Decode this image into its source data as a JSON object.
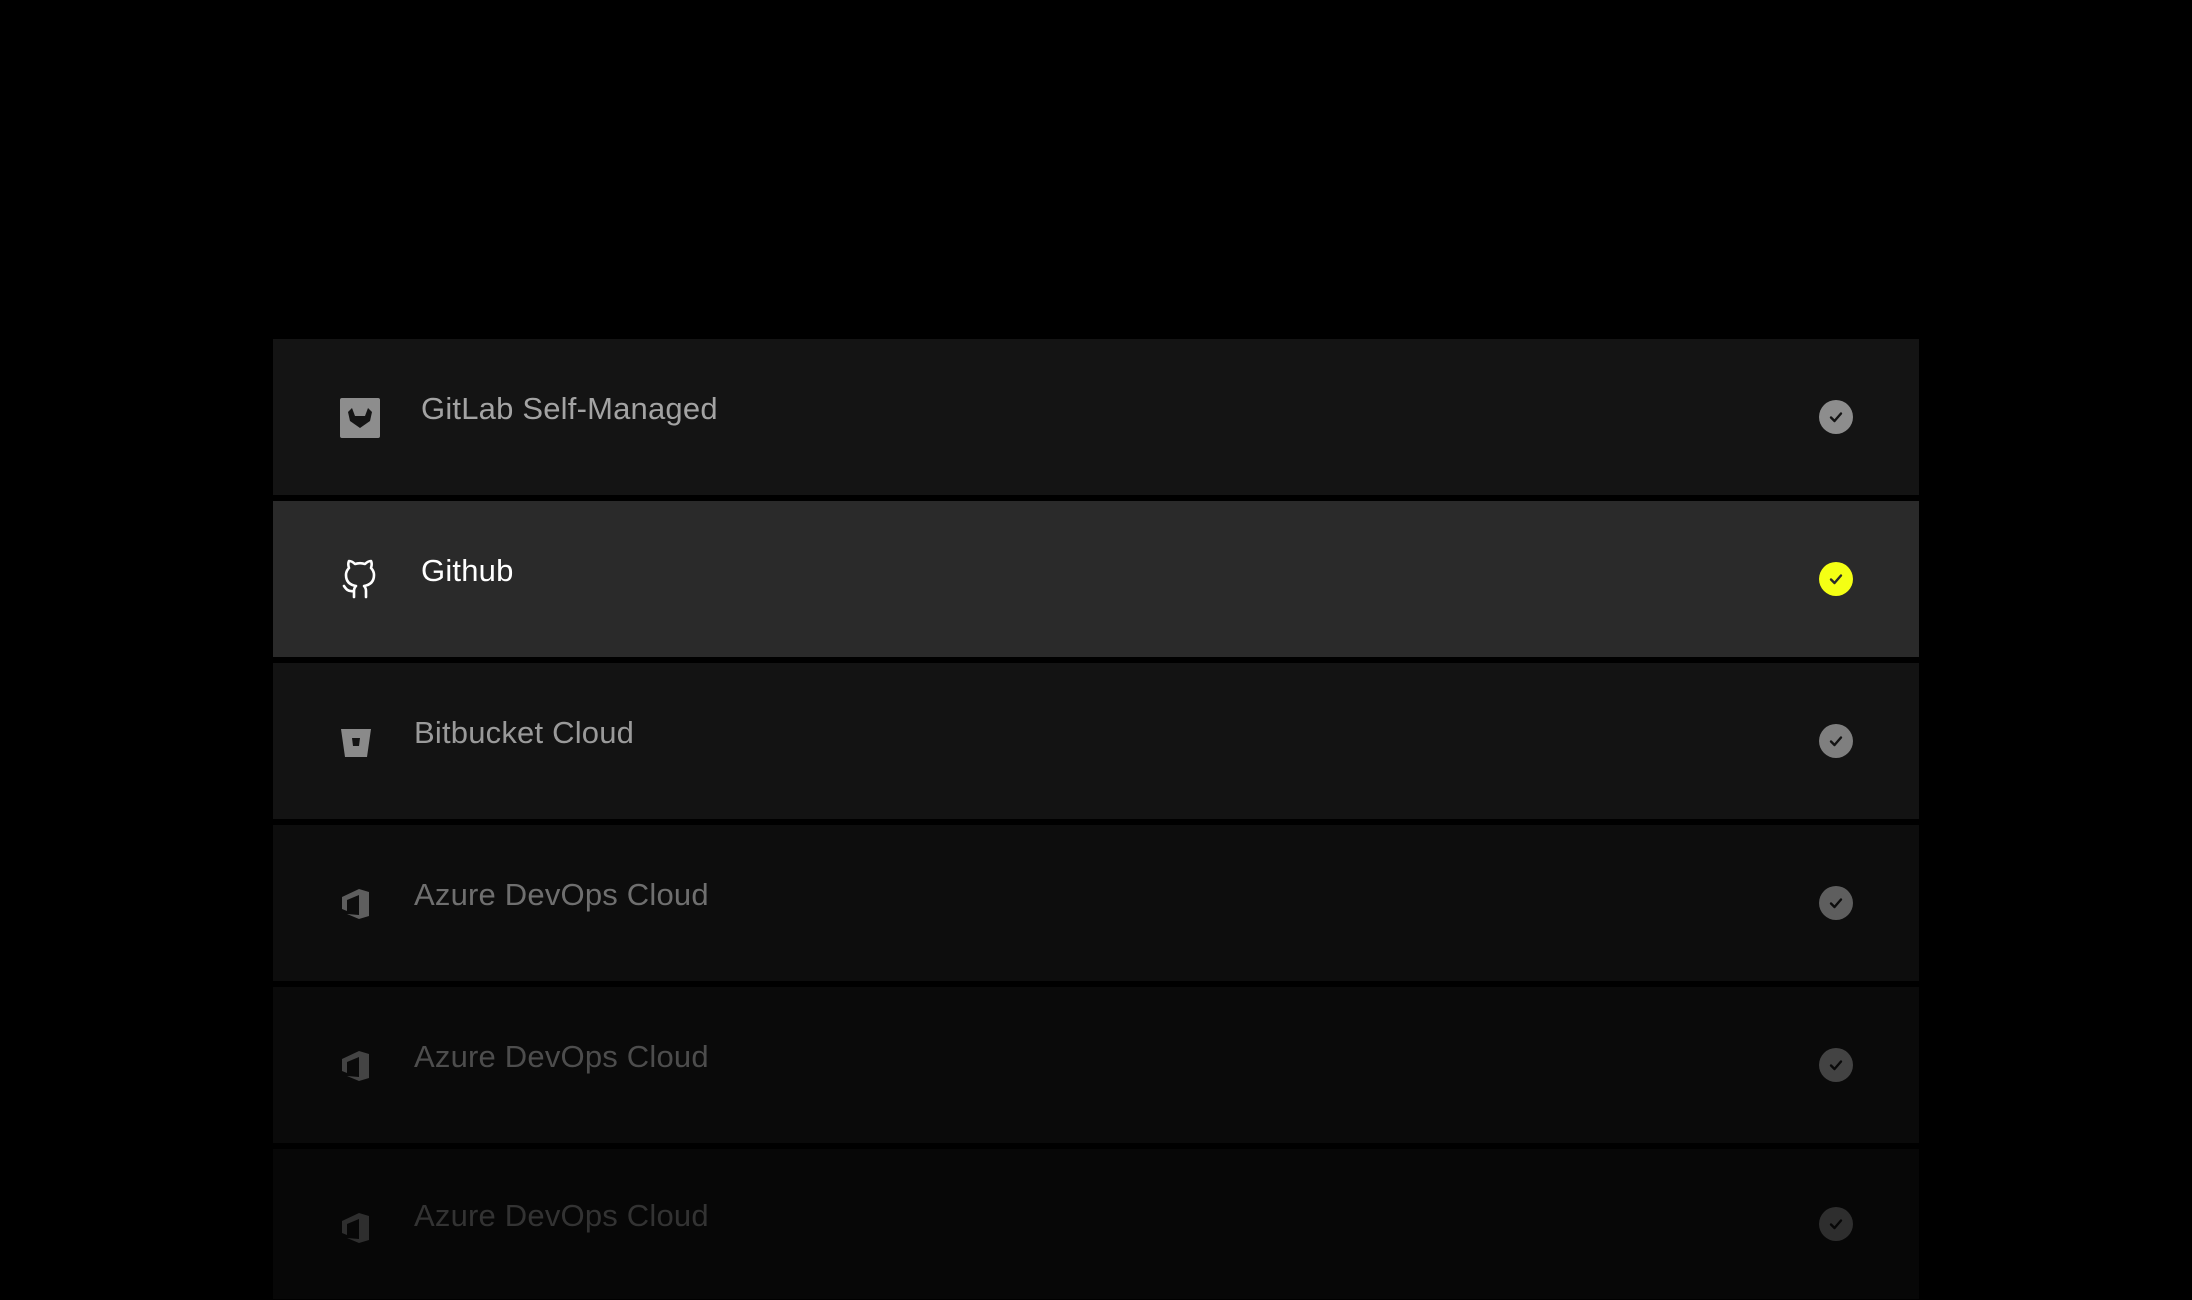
{
  "providers": [
    {
      "label": "GitLab Self-Managed",
      "icon": "gitlab-icon",
      "selected": false
    },
    {
      "label": "Github",
      "icon": "github-icon",
      "selected": true
    },
    {
      "label": "Bitbucket Cloud",
      "icon": "bitbucket-icon",
      "selected": false
    },
    {
      "label": "Azure DevOps Cloud",
      "icon": "azure-devops-icon",
      "selected": false
    },
    {
      "label": "Azure DevOps Cloud",
      "icon": "azure-devops-icon",
      "selected": false
    },
    {
      "label": "Azure DevOps Cloud",
      "icon": "azure-devops-icon",
      "selected": false
    }
  ],
  "colors": {
    "background": "#000000",
    "selected_row": "#2a2a2a",
    "accent_check": "#f4ff14",
    "row": "#141414"
  }
}
